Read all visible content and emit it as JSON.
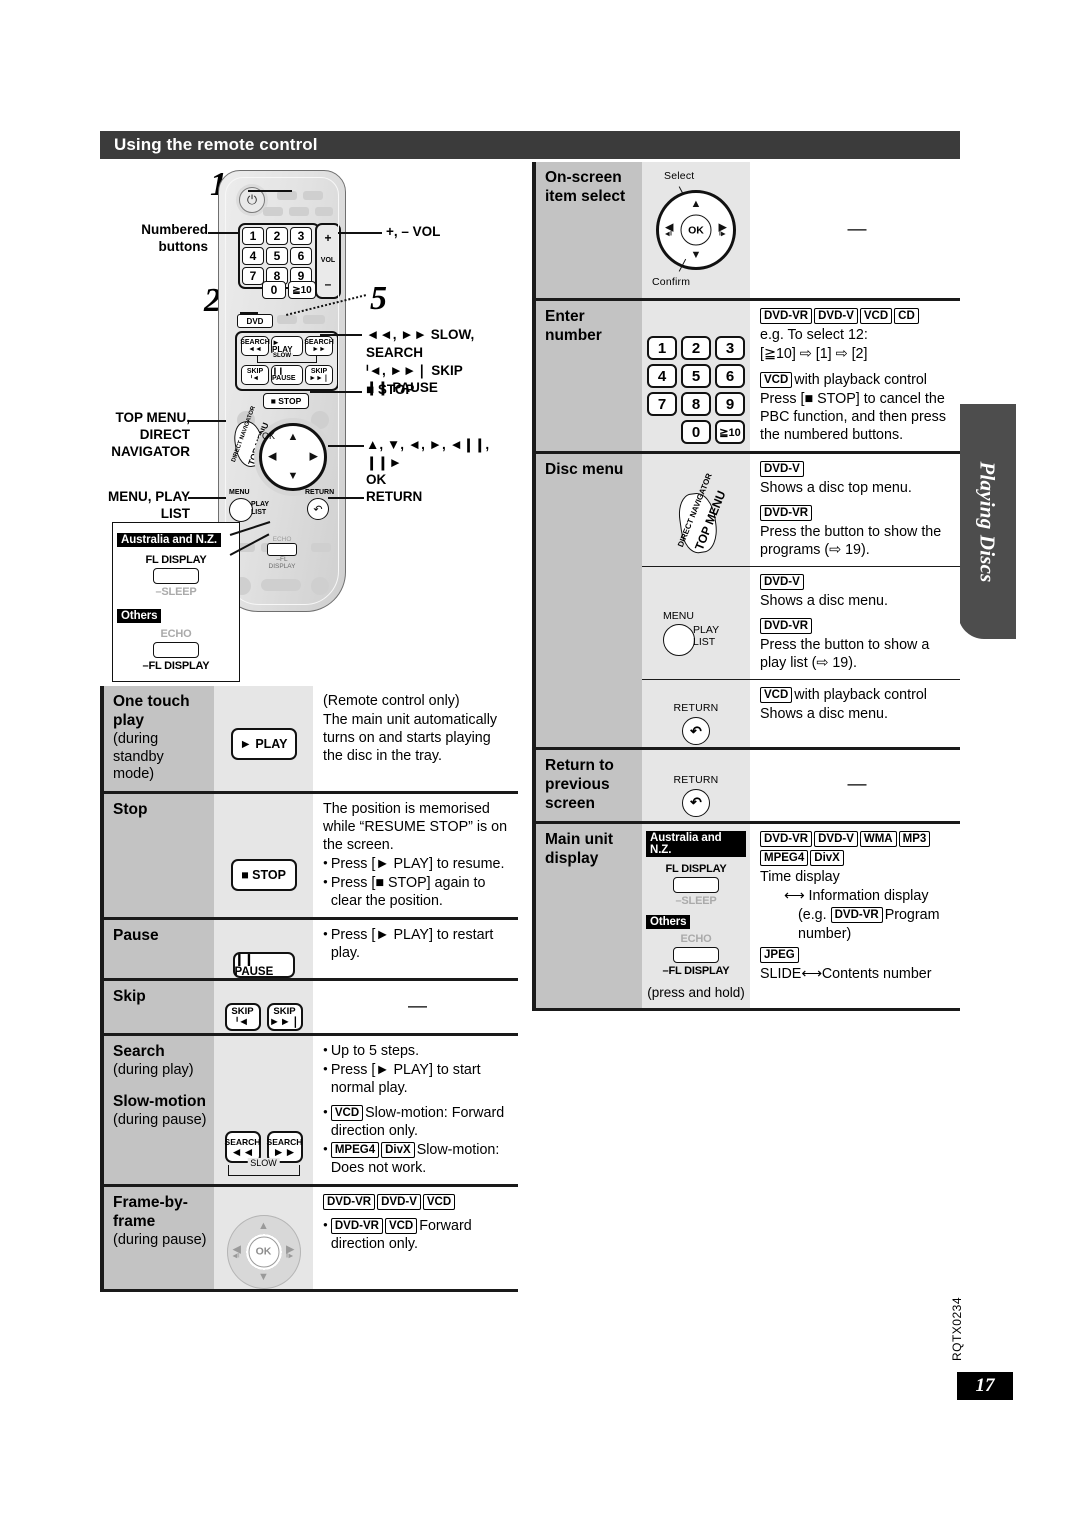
{
  "section": {
    "title": "Using the remote control"
  },
  "side_tab": {
    "label": "Playing Discs"
  },
  "footer": {
    "code": "RQTX0234",
    "page_number": "17"
  },
  "figure": {
    "steps": {
      "one": "1",
      "two": "2",
      "five": "5"
    },
    "labels": {
      "numbered_buttons": "Numbered\nbuttons",
      "vol": "+, – VOL",
      "slow_search": "◄◄, ►► SLOW, SEARCH",
      "skip": "ᑊ◄, ►►❘ SKIP",
      "pause": "❙❙ PAUSE",
      "stop": "■ STOP",
      "top_menu": "TOP MENU,\nDIRECT NAVIGATOR",
      "arrows": "▲, ▼, ◄, ►, ◄❙❙, ❙❙►",
      "ok": "OK",
      "menu_play_list": "MENU, PLAY LIST",
      "return": "RETURN"
    },
    "remote": {
      "power_icon": "power-icon",
      "keys": [
        "1",
        "2",
        "3",
        "4",
        "5",
        "6",
        "7",
        "8",
        "9",
        "0",
        "≧10"
      ],
      "vol_plus": "+",
      "vol_label": "VOL",
      "vol_minus": "–",
      "dvd": "DVD",
      "search_rev": {
        "top": "SEARCH",
        "bottom": "◄◄"
      },
      "play": "► PLAY",
      "search_fwd": {
        "top": "SEARCH",
        "bottom": "►►"
      },
      "skip_rev": {
        "top": "SKIP",
        "bottom": "ᑊ◄"
      },
      "pause": "❙❙ PAUSE",
      "skip_fwd": {
        "top": "SKIP",
        "bottom": "►►❘"
      },
      "slow": "SLOW",
      "stop": "■ STOP",
      "top_menu_line1": "DIRECT NAVIGATOR",
      "top_menu_line2": "TOP MENU",
      "menu": "MENU",
      "play_list": "PLAY\nLIST",
      "return": "RETURN",
      "ok": "OK",
      "echo_top": "ECHO",
      "echo_bottom": "–FL DISPLAY"
    },
    "region_callout": {
      "tag_aus": "Australia and N.Z.",
      "fl_display": "FL DISPLAY",
      "sleep": "–SLEEP",
      "tag_others": "Others",
      "echo": "ECHO",
      "fl_display_minus": "–FL DISPLAY"
    }
  },
  "left_table": {
    "rows": [
      {
        "label": "One touch",
        "label2": "play",
        "sub": "(during standby",
        "sub2": "mode)",
        "icon": "play-button",
        "icon_text": "► PLAY",
        "desc_lines": [
          "(Remote control only)",
          "The main unit automatically turns on and starts playing the disc in the tray."
        ],
        "bullets": []
      },
      {
        "label": "Stop",
        "icon": "stop-button",
        "icon_text": "■ STOP",
        "desc_lines": [
          "The position is memorised while “RESUME STOP” is on the screen."
        ],
        "bullets": [
          "Press [► PLAY] to resume.",
          "Press [■ STOP] again to clear the position."
        ]
      },
      {
        "label": "Pause",
        "icon": "pause-button",
        "icon_text": "❙❙ PAUSE",
        "desc_lines": [],
        "bullets": [
          "Press [► PLAY] to restart play."
        ]
      },
      {
        "label": "Skip",
        "icon": "skip-buttons",
        "skip_rev_top": "SKIP",
        "skip_rev_bottom": "ᑊ◄",
        "skip_fwd_top": "SKIP",
        "skip_fwd_bottom": "►►❘",
        "desc_dash": "—"
      },
      {
        "label": "Search",
        "sub": "(during play)",
        "label2": "Slow-motion",
        "sub2": "(during pause)",
        "icon": "search-buttons",
        "search_rev_top": "SEARCH",
        "search_rev_bottom": "◄◄",
        "search_fwd_top": "SEARCH",
        "search_fwd_bottom": "►►",
        "slow_label": "SLOW",
        "bullets": [
          "Up to 5 steps.",
          "Press [► PLAY] to start normal play."
        ],
        "bullet_vcd_chip": "VCD",
        "bullet_vcd_text": "Slow-motion: Forward direction only.",
        "bullet_mpeg_chips": [
          "MPEG4",
          "DivX"
        ],
        "bullet_mpeg_text": "Slow-motion: Does not work."
      },
      {
        "label": "Frame-by-",
        "label2": "frame",
        "sub2": "(during pause)",
        "icon": "dpad",
        "chips": [
          "DVD-VR",
          "DVD-V",
          "VCD"
        ],
        "bullet_chips": [
          "DVD-VR",
          "VCD"
        ],
        "bullet_text": "Forward direction only."
      }
    ]
  },
  "right_table": {
    "rows": [
      {
        "label": "On-screen",
        "label2": "item select",
        "icon": "dpad-select",
        "select_caption": "Select",
        "confirm_caption": "Confirm",
        "ok": "OK",
        "desc_dash": "—"
      },
      {
        "label": "Enter number",
        "icon": "numeric-keypad",
        "keys": [
          "1",
          "2",
          "3",
          "4",
          "5",
          "6",
          "7",
          "8",
          "9",
          "0",
          "≧10"
        ],
        "chips": [
          "DVD-VR",
          "DVD-V",
          "VCD",
          "CD"
        ],
        "desc_lines": [
          "e.g. To select 12:",
          "[≧10] ⇨ [1] ⇨ [2]"
        ],
        "vcd_chip": "VCD",
        "vcd_line": "with playback control",
        "desc_lines2": [
          "Press [■ STOP] to cancel the PBC function, and then press the numbered buttons."
        ]
      },
      {
        "label": "Disc menu",
        "subrows": [
          {
            "icon": "top-menu-dial",
            "icon_line1": "DIRECT NAVIGATOR",
            "icon_line2": "TOP MENU",
            "blocks": [
              {
                "chip": "DVD-V",
                "text": "Shows a disc top menu."
              },
              {
                "chip": "DVD-VR",
                "text": "Press the button to show the programs (⇨ 19)."
              }
            ]
          },
          {
            "icon": "menu-play-list-button",
            "icon_menu": "MENU",
            "icon_play": "PLAY",
            "icon_list": "LIST",
            "blocks": [
              {
                "chip": "DVD-V",
                "text": "Shows a disc menu."
              },
              {
                "chip": "DVD-VR",
                "text": "Press the button to show a play list (⇨ 19)."
              }
            ]
          },
          {
            "icon": "return-button",
            "icon_caption": "RETURN",
            "blocks": [
              {
                "chip": "VCD",
                "text": "with playback control",
                "inline": true
              },
              {
                "chip": "",
                "text": "Shows a disc menu."
              }
            ]
          }
        ]
      },
      {
        "label": "Return to",
        "label2": "previous",
        "label3": "screen",
        "icon": "return-button",
        "icon_caption": "RETURN",
        "desc_dash": "—"
      },
      {
        "label": "Main unit",
        "label2": "display",
        "icon": "fl-display-button",
        "region": {
          "tag_aus": "Australia and N.Z.",
          "fl_display": "FL DISPLAY",
          "sleep": "–SLEEP",
          "tag_others": "Others",
          "echo": "ECHO",
          "fl_display_minus": "–FL DISPLAY",
          "press_hold": "(press and hold)"
        },
        "chips": [
          "DVD-VR",
          "DVD-V",
          "WMA",
          "MP3",
          "MPEG4",
          "DivX"
        ],
        "desc_lines": [
          "Time display"
        ],
        "arrow_line": "⟷ Information display",
        "eg_prefix": "(e.g.",
        "eg_chip": "DVD-VR",
        "eg_suffix": "Program",
        "eg_line2": "number)",
        "jpeg_chip": "JPEG",
        "jpeg_line": "SLIDE⟷Contents number"
      }
    ]
  }
}
